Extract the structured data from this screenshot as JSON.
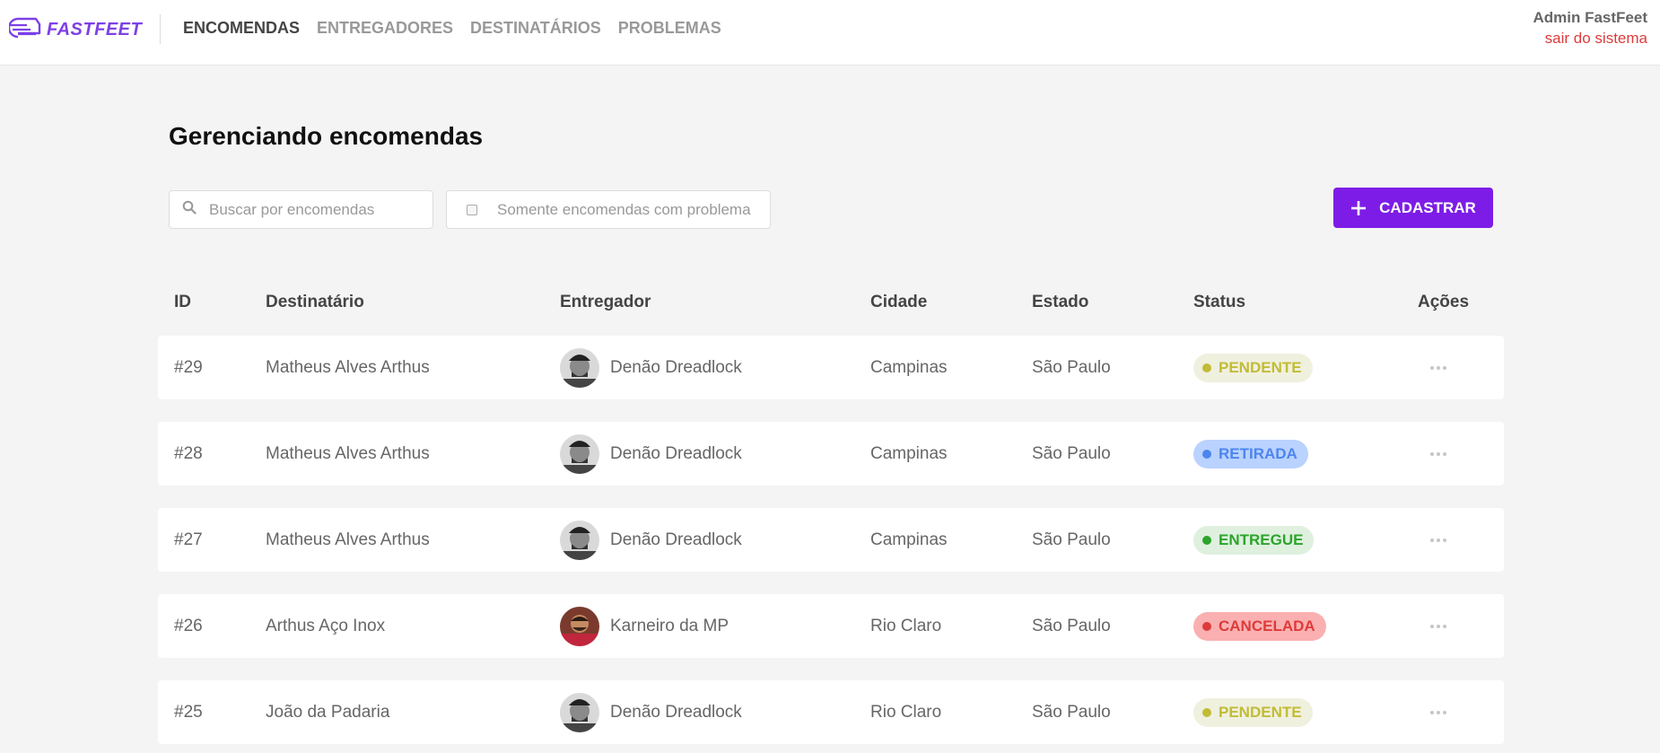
{
  "app": {
    "name": "FASTFEET",
    "colors": {
      "brand": "#7d40e7",
      "button": "#7d1ce7",
      "logout": "#de3b3b"
    }
  },
  "nav": {
    "items": [
      {
        "label": "ENCOMENDAS",
        "active": true
      },
      {
        "label": "ENTREGADORES",
        "active": false
      },
      {
        "label": "DESTINATÁRIOS",
        "active": false
      },
      {
        "label": "PROBLEMAS",
        "active": false
      }
    ]
  },
  "user": {
    "name": "Admin FastFeet",
    "logout_label": "sair do sistema"
  },
  "page": {
    "title": "Gerenciando encomendas"
  },
  "search": {
    "placeholder": "Buscar por encomendas",
    "value": "",
    "icon": "search-icon"
  },
  "filter": {
    "label": "Somente encomendas com problema",
    "checked": false
  },
  "toolbar": {
    "add_label": "CADASTRAR",
    "add_icon": "plus-icon"
  },
  "table": {
    "headers": [
      "ID",
      "Destinatário",
      "Entregador",
      "Cidade",
      "Estado",
      "Status",
      "Ações"
    ],
    "rows": [
      {
        "id": "#29",
        "recipient": "Matheus Alves Arthus",
        "deliverer": "Denão Dreadlock",
        "avatar": "bw",
        "city": "Campinas",
        "state": "São Paulo",
        "status": "PENDENTE",
        "status_kind": "pending"
      },
      {
        "id": "#28",
        "recipient": "Matheus Alves Arthus",
        "deliverer": "Denão Dreadlock",
        "avatar": "bw",
        "city": "Campinas",
        "state": "São Paulo",
        "status": "RETIRADA",
        "status_kind": "withdrawn"
      },
      {
        "id": "#27",
        "recipient": "Matheus Alves Arthus",
        "deliverer": "Denão Dreadlock",
        "avatar": "bw",
        "city": "Campinas",
        "state": "São Paulo",
        "status": "ENTREGUE",
        "status_kind": "delivered"
      },
      {
        "id": "#26",
        "recipient": "Arthus Aço Inox",
        "deliverer": "Karneiro da MP",
        "avatar": "color",
        "city": "Rio Claro",
        "state": "São Paulo",
        "status": "CANCELADA",
        "status_kind": "canceled"
      },
      {
        "id": "#25",
        "recipient": "João da Padaria",
        "deliverer": "Denão Dreadlock",
        "avatar": "bw",
        "city": "Rio Claro",
        "state": "São Paulo",
        "status": "PENDENTE",
        "status_kind": "pending"
      }
    ]
  },
  "status_styles": {
    "pending": {
      "bg": "#f0f0df",
      "fg": "#c1bc35"
    },
    "withdrawn": {
      "bg": "#bad2ff",
      "fg": "#4d85ee"
    },
    "delivered": {
      "bg": "#dff0df",
      "fg": "#2ca42b"
    },
    "canceled": {
      "bg": "#fab0b0",
      "fg": "#de3b3b"
    }
  }
}
